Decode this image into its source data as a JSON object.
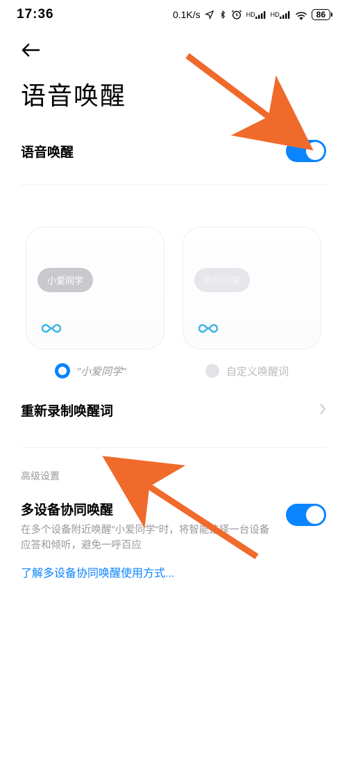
{
  "status": {
    "time": "17:36",
    "speed": "0.1K/s",
    "battery": "86"
  },
  "page_title": "语音唤醒",
  "voice_wake": {
    "title": "语音唤醒"
  },
  "cards": {
    "bubble1": "小爱同学",
    "bubble2": "你好小爱",
    "radio1": "\"小爱同学\"",
    "radio2": "自定义唤醒词"
  },
  "re_record": {
    "title": "重新录制唤醒词"
  },
  "advanced_header": "高级设置",
  "multi_device": {
    "title": "多设备协同唤醒",
    "desc": "在多个设备附近唤醒\"小爱同学\"时，将智能选择一台设备应答和倾听，避免一呼百应"
  },
  "learn_more": "了解多设备协同唤醒使用方式..."
}
